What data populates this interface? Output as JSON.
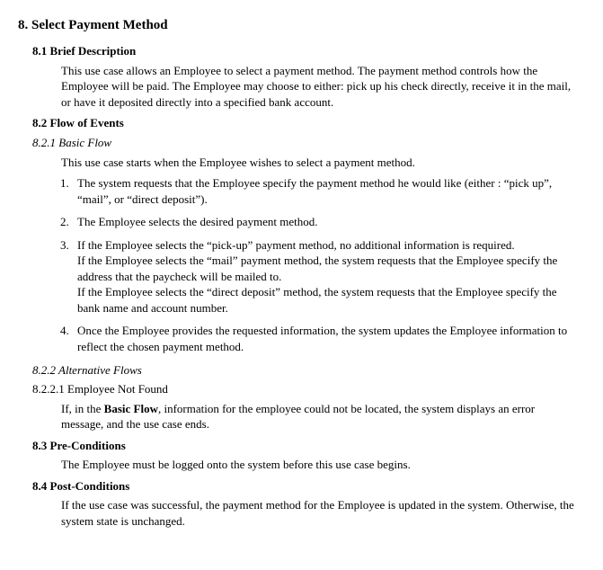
{
  "section": {
    "number": "8.",
    "title": "Select Payment Method",
    "s1": {
      "heading": "8.1 Brief Description",
      "body": "This use case allows an Employee to select a payment method.  The payment method controls how the Employee will be paid.  The Employee may choose to either: pick up his check directly, receive it in the mail, or have it deposited directly into a specified bank account."
    },
    "s2": {
      "heading": "8.2 Flow of Events",
      "basic": {
        "heading": "8.2.1 Basic Flow",
        "intro": "This use case starts when the Employee wishes to select a payment method.",
        "steps": [
          "The system requests that the Employee specify the payment method he would like (either : “pick up”, “mail”, or “direct deposit”).",
          "The Employee selects the desired payment method.",
          "If the Employee selects the “pick-up” payment method, no additional information is required.\nIf the Employee selects the “mail” payment method, the system requests that the Employee specify the address that the paycheck will be mailed to.\nIf the Employee selects the “direct deposit” method, the system requests that the Employee specify the bank name and account number.",
          "Once the Employee provides the requested information, the system updates the Employee information to reflect the chosen payment method."
        ]
      },
      "alt": {
        "heading": "8.2.2 Alternative Flows",
        "a1": {
          "heading": "8.2.2.1 Employee Not Found",
          "prefix": "If, in the ",
          "bold": "Basic Flow",
          "suffix": ", information for the employee could not be located, the system displays an error message, and the use case ends."
        }
      }
    },
    "s3": {
      "heading": "8.3 Pre-Conditions",
      "body": "The Employee must be logged onto the system before this use case begins."
    },
    "s4": {
      "heading": "8.4 Post-Conditions",
      "body": "If the use case was successful, the payment method for the Employee is updated in the system.  Otherwise, the system state is unchanged."
    }
  }
}
